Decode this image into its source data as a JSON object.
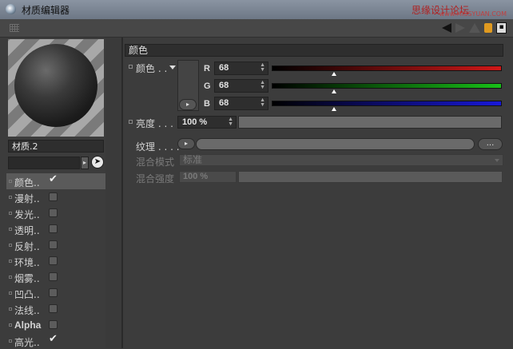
{
  "window": {
    "title": "材质编辑器",
    "watermark": "思缘设计论坛",
    "watermark_url": "www.MISSYUAN.COM"
  },
  "toolbar": {
    "icons": [
      "back-arrow-icon",
      "forward-arrow-icon",
      "up-arrow-icon",
      "lock-icon",
      "menu-icon"
    ]
  },
  "material": {
    "name": "材质.2",
    "link_value": ""
  },
  "channels": [
    {
      "label": "颜色",
      "dots": "..",
      "checked": true,
      "selected": true
    },
    {
      "label": "漫射",
      "dots": "..",
      "checked": false
    },
    {
      "label": "发光",
      "dots": "..",
      "checked": false
    },
    {
      "label": "透明",
      "dots": "..",
      "checked": false
    },
    {
      "label": "反射",
      "dots": "..",
      "checked": false
    },
    {
      "label": "环境",
      "dots": "..",
      "checked": false
    },
    {
      "label": "烟雾",
      "dots": "..",
      "checked": false
    },
    {
      "label": "凹凸",
      "dots": "..",
      "checked": false
    },
    {
      "label": "法线",
      "dots": "..",
      "checked": false
    },
    {
      "label": "Alpha",
      "dots": "",
      "checked": false
    },
    {
      "label": "高光",
      "dots": "..",
      "checked": true
    }
  ],
  "color_section": {
    "header": "颜色",
    "color_label": "颜色 . .",
    "r_label": "R",
    "r_value": "68",
    "r_level": 0.27,
    "g_label": "G",
    "g_value": "68",
    "g_level": 0.27,
    "b_label": "B",
    "b_value": "68",
    "b_level": 0.27,
    "brightness_label": "亮度 . . . .",
    "brightness_value": "100 %",
    "texture_label": "纹理 . . . .",
    "texture_more": "...",
    "blend_mode_label": "混合模式",
    "blend_mode_value": "标准",
    "blend_strength_label": "混合强度",
    "blend_strength_value": "100 %"
  },
  "colors": {
    "red": "#d01818",
    "green": "#18c018",
    "blue": "#1818d8"
  }
}
